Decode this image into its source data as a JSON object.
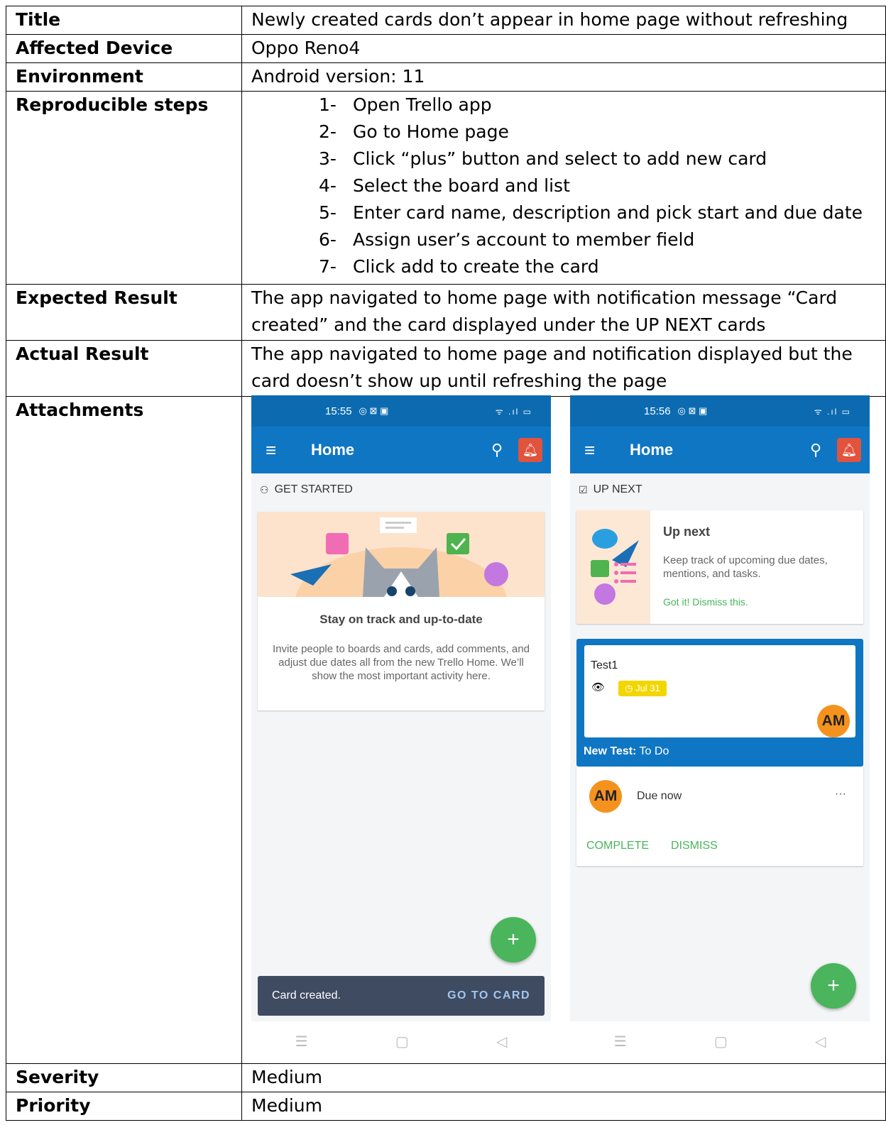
{
  "report": {
    "title_label": "Title",
    "title_value": "Newly created cards don’t appear in home page without refreshing",
    "device_label": "Affected Device",
    "device_value": "Oppo Reno4",
    "environment_label": "Environment",
    "environment_value": "Android version: 11",
    "steps_label": "Reproducible steps",
    "steps": [
      {
        "num": "1-",
        "text": "Open Trello app"
      },
      {
        "num": "2-",
        "text": "Go to Home page"
      },
      {
        "num": "3-",
        "text": "Click “plus” button and select to add new card"
      },
      {
        "num": "4-",
        "text": "Select the board and list"
      },
      {
        "num": "5-",
        "text": "Enter card name, description and pick start and due date"
      },
      {
        "num": "6-",
        "text": "Assign user’s account to member field"
      },
      {
        "num": "7-",
        "text": "Click add to create the card"
      }
    ],
    "expected_label": "Expected Result",
    "expected_value": "The app navigated to home page with notification message “Card created” and the card displayed under the UP NEXT cards",
    "actual_label": "Actual Result",
    "actual_value": "The app navigated to home page and notification displayed but the card doesn’t show up until refreshing the page",
    "attachments_label": "Attachments",
    "severity_label": "Severity",
    "severity_value": "Medium",
    "priority_label": "Priority",
    "priority_value": "Medium"
  },
  "screen1": {
    "time": "15:55",
    "status_icons": "◎ ⊠ ▣",
    "signal": "ᯤ .ıl ▭",
    "title": "Home",
    "section": "GET STARTED",
    "heading": "Stay on track and up-to-date",
    "body": "Invite people to boards and cards, add comments, and adjust due dates all from the new Trello Home. We’ll show the most important activity here.",
    "snackbar_text": "Card created.",
    "snackbar_action": "GO TO CARD",
    "fab": "+"
  },
  "screen2": {
    "time": "15:56",
    "status_icons": "◎ ⊠ ▣",
    "signal": "ᯤ .ıl ▭",
    "title": "Home",
    "section": "UP NEXT",
    "promo_title": "Up next",
    "promo_body": "Keep track of upcoming due dates, mentions, and tasks.",
    "promo_link": "Got it! Dismiss this.",
    "card_title": "Test1",
    "due_badge": "Jul 31",
    "avatar": "AM",
    "board": "New Test:",
    "list": " To Do",
    "due_text": "Due now",
    "more": "···",
    "complete": "COMPLETE",
    "dismiss": "DISMISS",
    "fab": "+"
  },
  "colors": {
    "appbar": "#0f76c4",
    "fab": "#4ab55c",
    "bell": "#e0533d",
    "avatar": "#f5921e",
    "action_green": "#4ab55c",
    "snackbar": "#3f4b61"
  }
}
